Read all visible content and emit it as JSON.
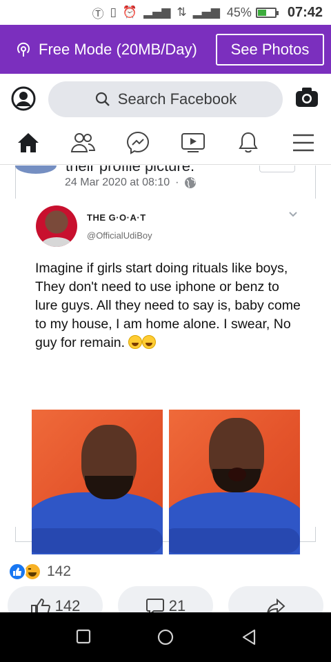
{
  "status_bar": {
    "icons": [
      "nfc-icon",
      "vibrate-icon",
      "alarm-icon",
      "signal-icon",
      "data-arrows-icon",
      "signal-h-plus-icon"
    ],
    "battery_percent": "45%",
    "battery_level": 0.45,
    "time": "07:42"
  },
  "banner": {
    "free_mode_text": "Free Mode (20MB/Day)",
    "see_photos_label": "See Photos",
    "color": "#7b2fbe"
  },
  "search": {
    "placeholder": "Search Facebook"
  },
  "nav": {
    "items": [
      "home-icon",
      "friends-icon",
      "messenger-icon",
      "watch-icon",
      "notifications-icon",
      "menu-icon"
    ]
  },
  "post": {
    "cut_title": "their profile picture.",
    "date": "24 Mar 2020 at 08:10",
    "dot": "·",
    "tweet": {
      "name": "THE G·O·A·T",
      "handle": "@OfficialUdiBoy",
      "text": "Imagine if girls start doing rituals like boys, They don't need to use iphone or benz to lure guys. All they need to say is, baby come to my house, I am home alone. I swear, No guy for remain."
    },
    "reaction_count": "142",
    "like_count": "142",
    "comment_count": "21"
  },
  "colors": {
    "facebook_blue": "#1877f2",
    "haha_yellow": "#f7b125"
  }
}
